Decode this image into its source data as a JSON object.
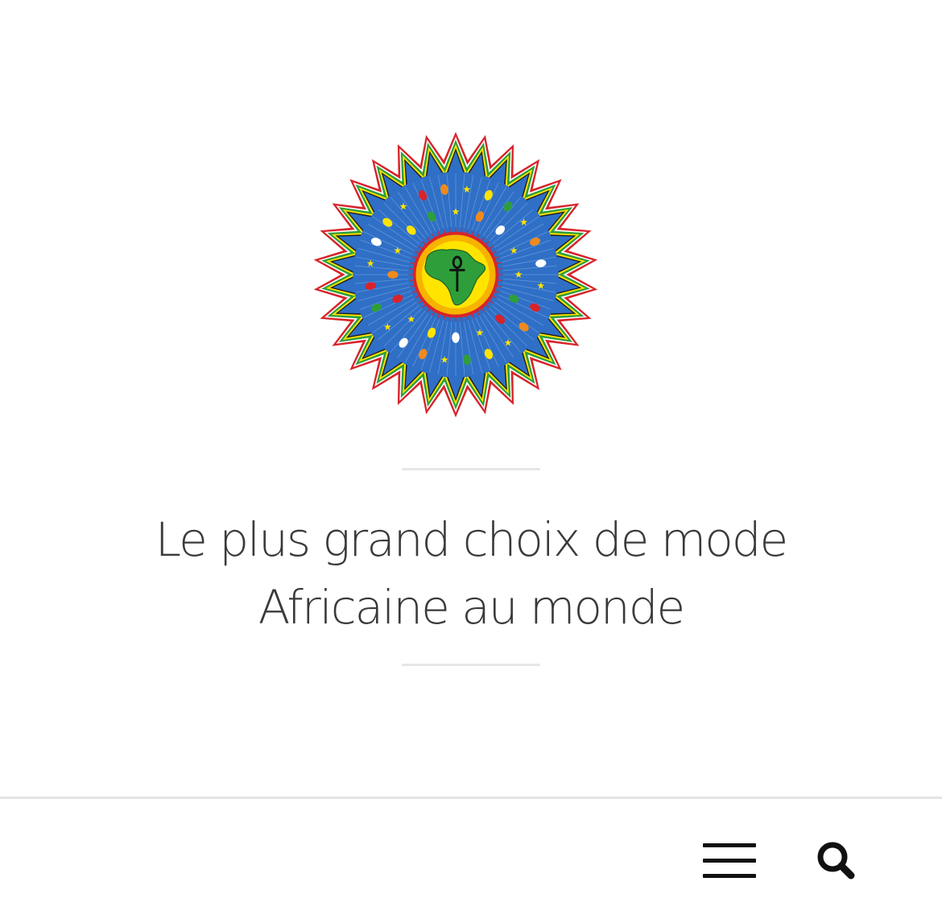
{
  "hero": {
    "logo_icon": "african-sun-emblem-icon",
    "tagline_line1": "Le plus grand choix de mode",
    "tagline_line2": "Africaine au monde"
  },
  "bottom_bar": {
    "menu_icon": "hamburger-menu-icon",
    "search_icon": "search-icon"
  },
  "colors": {
    "background": "#ffffff",
    "text": "#3a3a3a",
    "divider": "#e6e6e6",
    "emblem_blue": "#2f6fc6",
    "emblem_yellow": "#ffe400",
    "emblem_green": "#2e9e3b",
    "emblem_red": "#d8232a",
    "icon": "#111111"
  }
}
